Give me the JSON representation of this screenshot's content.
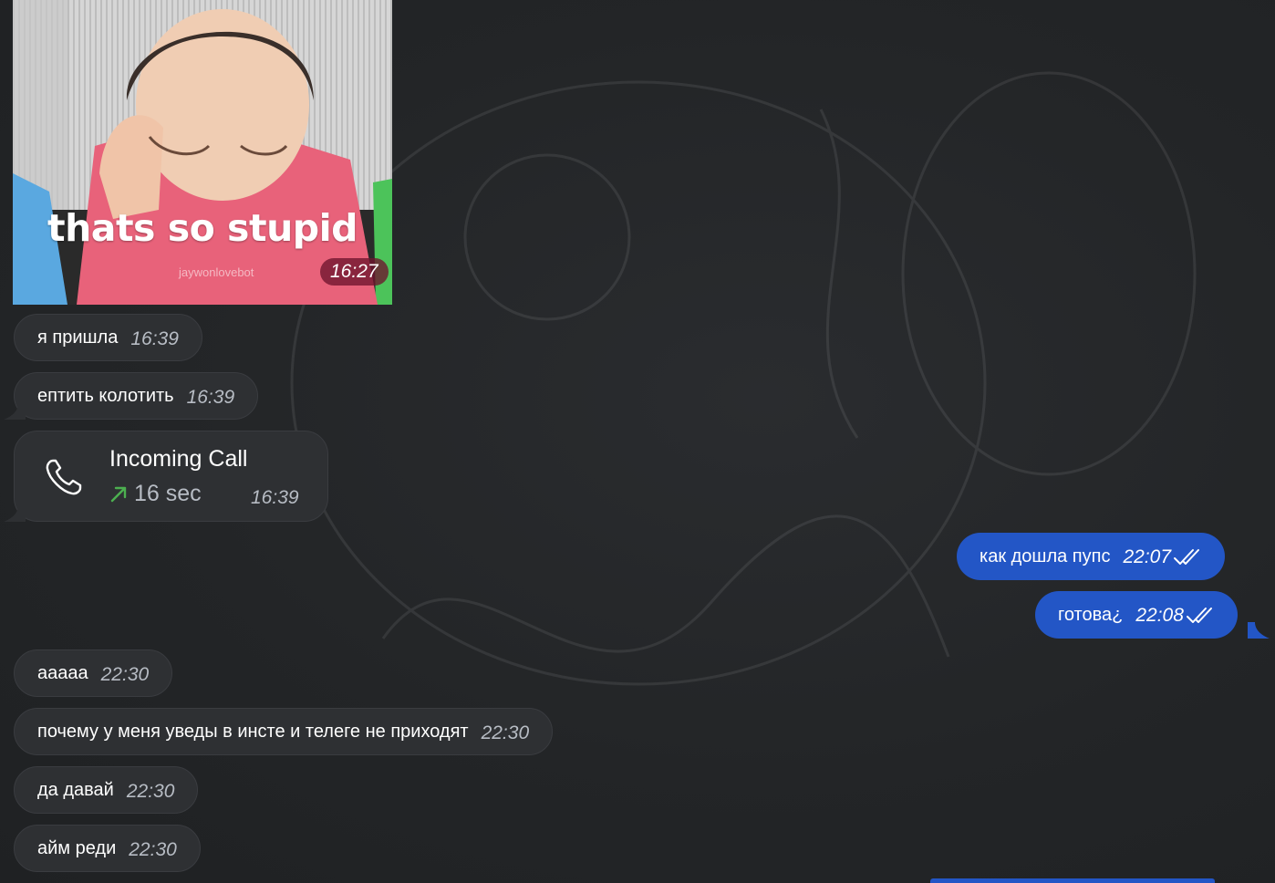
{
  "sticker": {
    "caption": "thats so stupid",
    "watermark": "jaywonlovebot",
    "time": "16:27"
  },
  "messages": [
    {
      "text": "я пришла",
      "time": "16:39"
    },
    {
      "text": "ептить колотить",
      "time": "16:39"
    }
  ],
  "call": {
    "title": "Incoming Call",
    "duration": "16 sec",
    "time": "16:39",
    "arrow_color": "#4caf50"
  },
  "outgoing": [
    {
      "text": "как дошла пупс",
      "time": "22:07"
    },
    {
      "text": "готова¿",
      "time": "22:08"
    }
  ],
  "later_messages": [
    {
      "text": "ааааа",
      "time": "22:30"
    },
    {
      "text": "почему у меня уведы в инсте и телеге не приходят",
      "time": "22:30"
    },
    {
      "text": "да давай",
      "time": "22:30"
    },
    {
      "text": "айм реди",
      "time": "22:30"
    }
  ],
  "colors": {
    "background": "#232527",
    "incoming_bubble": "#2e3033",
    "outgoing_bubble": "#2356c6",
    "timestamp": "#b7bcc4"
  },
  "icons": {
    "call": "phone-icon",
    "call_direction": "arrow-up-right-icon",
    "read_status": "double-check-icon"
  }
}
